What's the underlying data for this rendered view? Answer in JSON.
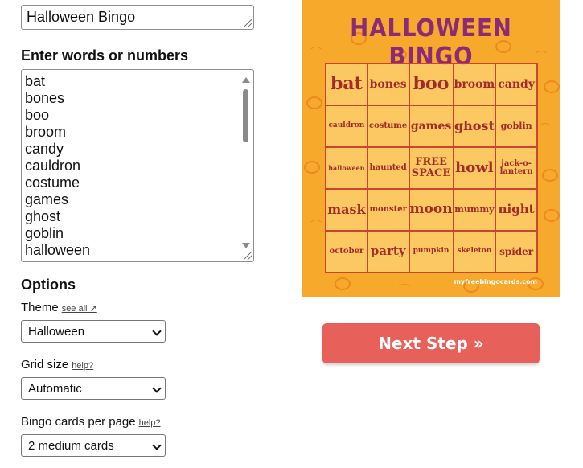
{
  "form": {
    "title_value": "Halloween Bingo",
    "words_heading": "Enter words or numbers",
    "words": [
      "bat",
      "bones",
      "boo",
      "broom",
      "candy",
      "cauldron",
      "costume",
      "games",
      "ghost",
      "goblin",
      "halloween"
    ],
    "options_heading": "Options",
    "theme": {
      "label": "Theme",
      "help": "see all ↗",
      "value": "Halloween"
    },
    "grid_size": {
      "label": "Grid size",
      "help": "help?",
      "value": "Automatic"
    },
    "cards_per_page": {
      "label": "Bingo cards per page",
      "help": "help?",
      "value": "2 medium cards"
    }
  },
  "preview": {
    "title": "HALLOWEEN BINGO",
    "cells": [
      "bat",
      "bones",
      "boo",
      "broom",
      "candy",
      "cauldron",
      "costume",
      "games",
      "ghost",
      "goblin",
      "halloween",
      "haunted",
      "FREE SPACE",
      "howl",
      "jack-o-lantern",
      "mask",
      "monster",
      "moon",
      "mummy",
      "night",
      "october",
      "party",
      "pumpkin",
      "skeleton",
      "spider"
    ],
    "watermark": "myfreebingocards.com",
    "background_color": "#f7a92b",
    "cell_text_color": "#a52a2a",
    "title_color": "#8c2a78"
  },
  "actions": {
    "next_label": "Next Step »",
    "next_color": "#e8605a"
  }
}
